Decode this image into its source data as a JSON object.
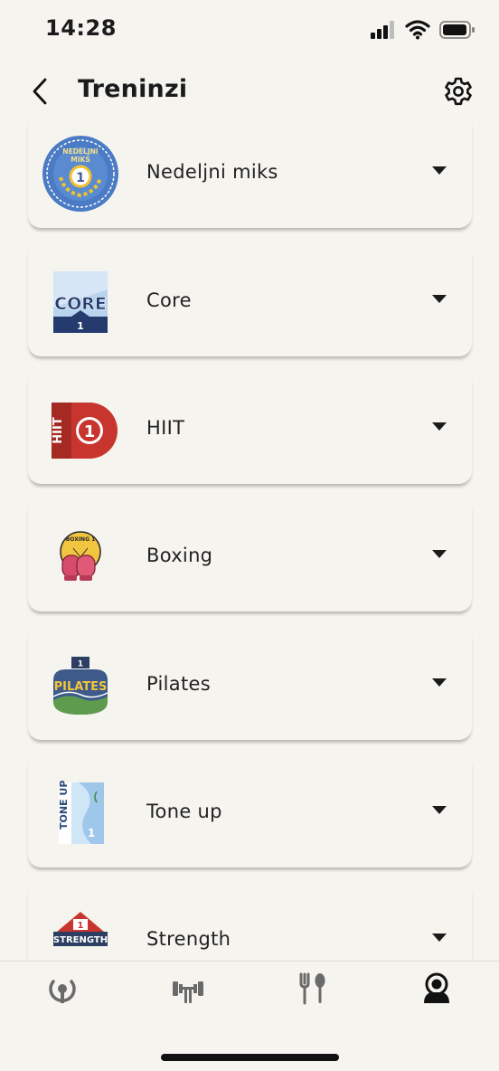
{
  "status": {
    "time": "14:28"
  },
  "header": {
    "title": "Treninzi"
  },
  "workouts": [
    {
      "label": "Nedeljni miks",
      "badge_text": "NEDELJNI MIKS",
      "level": "1"
    },
    {
      "label": "Core",
      "badge_text": "CORE",
      "level": "1"
    },
    {
      "label": "HIIT",
      "badge_text": "HIIT",
      "level": "1"
    },
    {
      "label": "Boxing",
      "badge_text": "BOXING 1",
      "level": "1"
    },
    {
      "label": "Pilates",
      "badge_text": "PILATES",
      "level": "1"
    },
    {
      "label": "Tone up",
      "badge_text": "TONE UP",
      "level": "1"
    },
    {
      "label": "Strength",
      "badge_text": "STRENGTH",
      "level": "1"
    }
  ],
  "tabbar": {
    "items": [
      {
        "icon": "progress-icon"
      },
      {
        "icon": "workouts-icon"
      },
      {
        "icon": "nutrition-icon"
      },
      {
        "icon": "profile-icon",
        "active": true
      }
    ]
  },
  "colors": {
    "background": "#f6f4ef",
    "text": "#1b1b1b"
  }
}
